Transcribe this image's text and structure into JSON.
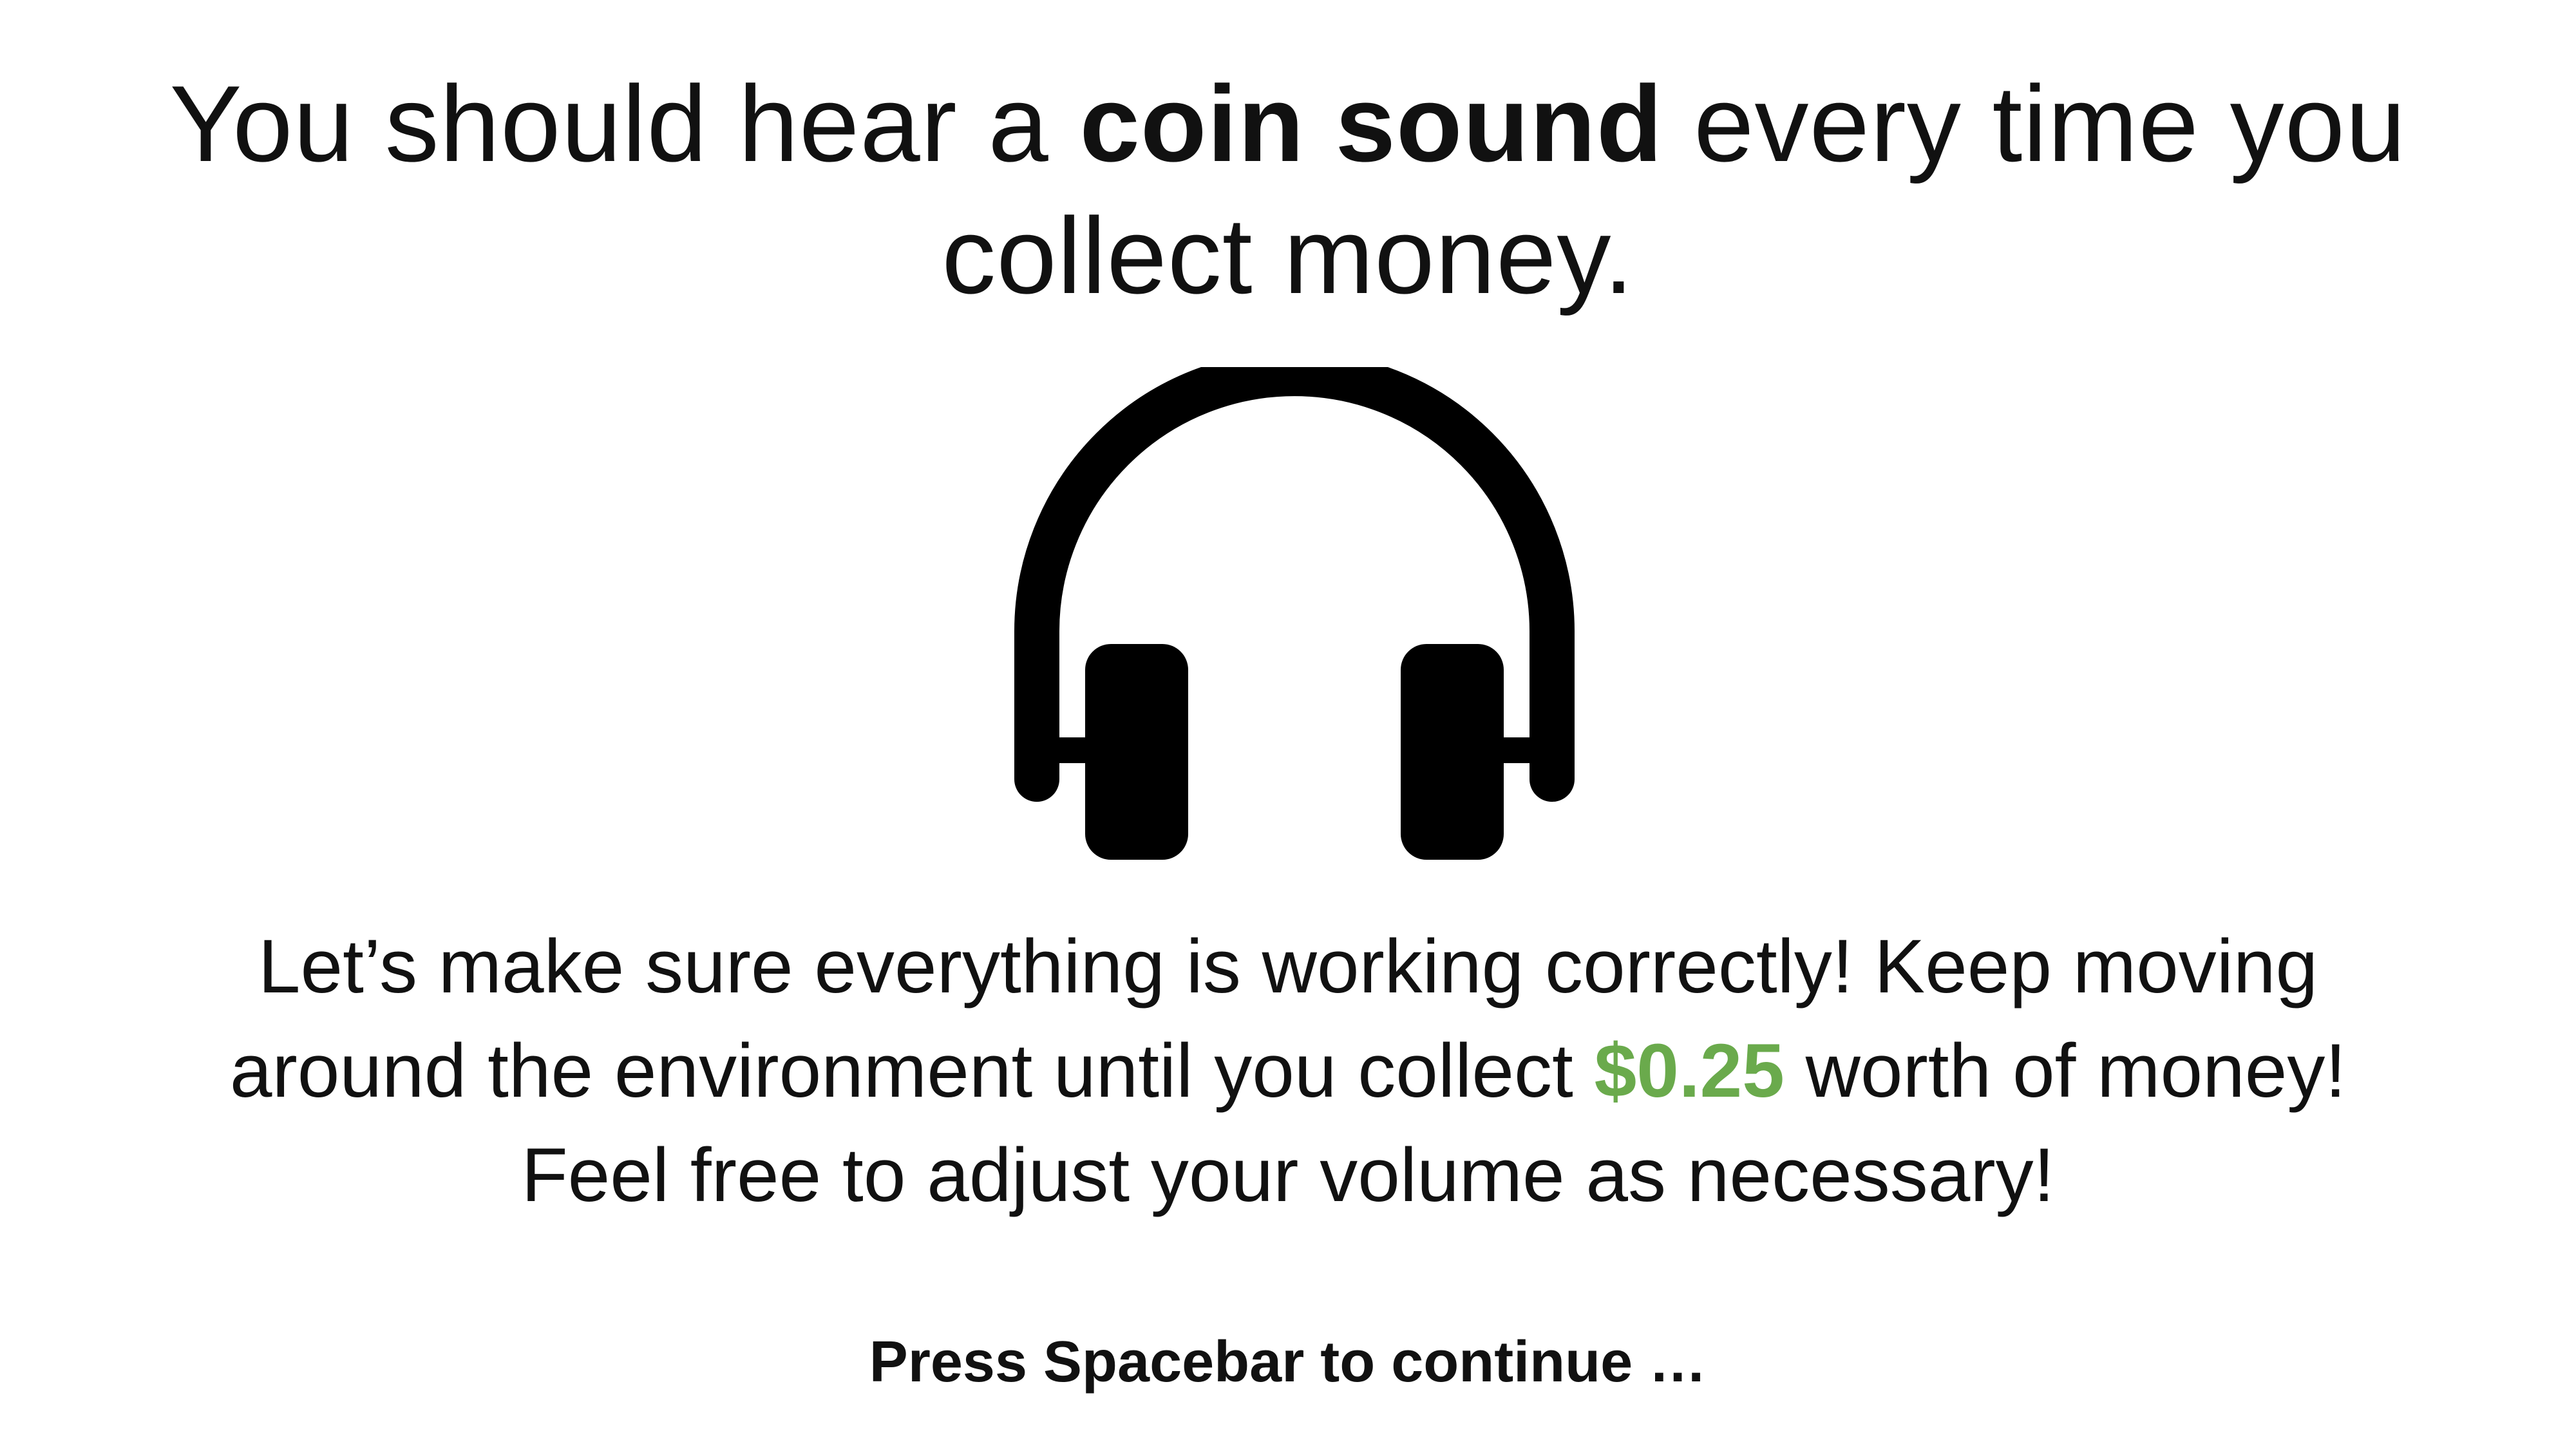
{
  "headline": {
    "prefix": "You should hear a ",
    "bold": "coin sound",
    "suffix": " every time you collect money."
  },
  "icon": "headphones-icon",
  "instructions": {
    "line1": "Let’s make sure everything is working correctly! Keep moving",
    "line2_prefix": "around the environment until you collect ",
    "amount": "$0.25",
    "line2_suffix": " worth of money!",
    "line3": "Feel free to adjust your volume as necessary!"
  },
  "continue_prompt": "Press Spacebar to continue …",
  "colors": {
    "background": "#ffffff",
    "text": "#111111",
    "amount_accent": "#6aaa4c"
  }
}
